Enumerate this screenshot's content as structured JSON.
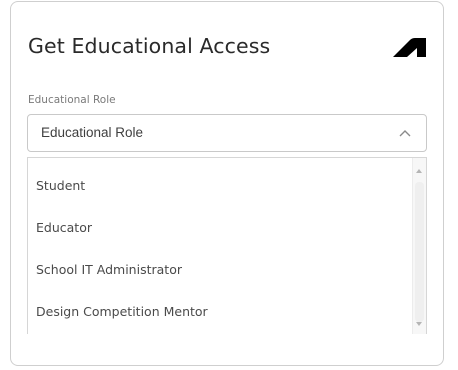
{
  "header": {
    "title": "Get Educational Access",
    "logo_icon": "autodesk-logo-icon"
  },
  "educational_role": {
    "label": "Educational Role",
    "selected_value": "Educational Role",
    "expanded": true,
    "chevron_icon": "chevron-up-icon",
    "options": [
      "Student",
      "Educator",
      "School IT Administrator",
      "Design Competition Mentor"
    ]
  },
  "colors": {
    "text_primary": "#2a2a2a",
    "text_secondary": "#7a7a7a",
    "border": "#cfcfcf",
    "logo": "#000000"
  }
}
